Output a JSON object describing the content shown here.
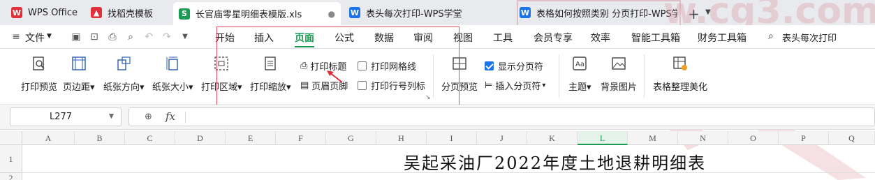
{
  "tabs": [
    {
      "label": "WPS Office",
      "icon": "wps-logo-icon",
      "color": "#e0303a"
    },
    {
      "label": "找稻壳模板",
      "icon": "docer-icon",
      "color": "#e0303a"
    },
    {
      "label": "长官庙零星明细表模版.xls",
      "icon": "spreadsheet-icon",
      "color": "#1a9a52",
      "active": true
    },
    {
      "label": "表头每次打印-WPS学堂",
      "icon": "wps-academy-icon",
      "color": "#1a73e8"
    },
    {
      "label": "表格如何按照类别 分页打印-WPS学堂",
      "icon": "wps-academy-icon",
      "color": "#1a73e8"
    }
  ],
  "menu": {
    "file_label": "文件",
    "items": [
      "开始",
      "插入",
      "页面",
      "公式",
      "数据",
      "审阅",
      "视图",
      "工具",
      "会员专享",
      "效率",
      "智能工具箱",
      "财务工具箱"
    ],
    "active": "页面",
    "search_label": "表头每次打印"
  },
  "ribbon": {
    "print_preview": "打印预览",
    "margins": "页边距",
    "orientation": "纸张方向",
    "paper_size": "纸张大小",
    "print_area": "打印区域",
    "print_scale": "打印缩放",
    "print_titles": "打印标题",
    "header_footer": "页眉页脚",
    "print_gridlines": "打印网格线",
    "print_row_col_headers": "打印行号列标",
    "page_break_preview": "分页预览",
    "show_page_breaks": "显示分页符",
    "insert_page_break": "插入分页符",
    "theme": "主题",
    "background_image": "背景图片",
    "table_beautify": "表格整理美化",
    "show_page_breaks_checked": true,
    "print_gridlines_checked": false,
    "print_row_col_headers_checked": false
  },
  "formula_bar": {
    "name_box": "L277",
    "fx_label": "fx",
    "value": ""
  },
  "grid": {
    "columns": [
      "A",
      "B",
      "C",
      "D",
      "E",
      "F",
      "G",
      "H",
      "I",
      "J",
      "K",
      "L",
      "M",
      "N",
      "O",
      "P",
      "Q"
    ],
    "selected_column": "L",
    "rows": [
      "1",
      "2"
    ],
    "title_cell": "吴起采油厂2022年度土地退耕明细表"
  },
  "watermark_text": "w.cg3.com",
  "colors": {
    "accent": "#1a9a52",
    "highlight": "#e04a5a",
    "check": "#1a73e8"
  }
}
